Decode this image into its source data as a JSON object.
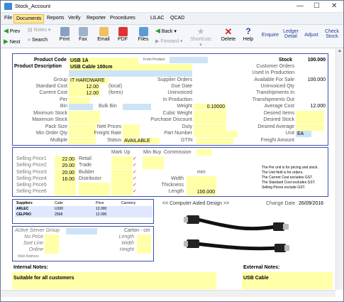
{
  "window": {
    "title": "Stock_Account",
    "min": "—",
    "max": "☐",
    "close": "✕"
  },
  "menu": [
    "File",
    "Documents",
    "Reports",
    "Verify",
    "Reporter",
    "Procedures",
    "LILAC",
    "QCAD"
  ],
  "toolbar": {
    "prev": "Prev",
    "next": "Next",
    "notes": "Notes",
    "search": "Search",
    "print": "Print",
    "fax": "Fax",
    "email": "Email",
    "pdf": "PDF",
    "files": "Files",
    "back": "Back",
    "forward": "Forward",
    "shortcuts": "Shortcuts",
    "delete": "Delete",
    "help": "Help",
    "enquire": "Enquire",
    "ledger1": "Ledger",
    "ledger2": "Detail",
    "adjust": "Adjust",
    "check1": "Check",
    "check2": "Stock"
  },
  "product": {
    "code_label": "Product Code",
    "code": "USB 1A",
    "from_product_label": "From Product",
    "desc_label": "Product Description",
    "desc": "USB Cable 100cm",
    "group_label": "Group",
    "group": "IT HARDWARE",
    "std_cost_label": "Standard Cost",
    "std_cost": "12.00",
    "local": "(local)",
    "cur_cost_label": "Current Cost",
    "cur_cost": "12.00",
    "forex": "(forex)",
    "per_label": "Per",
    "bin_label": "Bin",
    "bulk_bin_label": "Bulk Bin",
    "min_stock_label": "Minimum Stock",
    "max_stock_label": "Maximum Stock",
    "pack_size_label": "Pack Size",
    "nett_prices_label": "Nett Prices",
    "min_order_label": "Min Order Qty",
    "freight_rate_label": "Freight Rate",
    "multiple_label": "Multiple",
    "status_label": "Status",
    "status": "AVAILABLE",
    "gtin_label": "GTIN",
    "supplier_orders_label": "Supplier Orders",
    "due_date_label": "Due Date",
    "uninvoiced_label": "Uninvoiced",
    "in_production_label": "In Production",
    "weight_label": "Weight",
    "weight": "0.10000",
    "cubic_weight_label": "Cubic Weight",
    "purchase_discount_label": "Purchase Discount",
    "duty_label": "Duty",
    "part_number_label": "Part Number"
  },
  "stock": {
    "stock_label": "Stock",
    "stock": "100.000",
    "customer_orders_label": "Customer Orders",
    "used_in_production_label": "Used In Production",
    "available_label": "Available For Sale",
    "available": "100.000",
    "uninvoiced_qty_label": "Uninvoiced Qty",
    "transhipments_in_label": "Transhipments In",
    "transhipments_out_label": "Transhipments Out",
    "average_cost_label": "Average Cost",
    "average_cost": "12.000",
    "desired_items_label": "Desired Items",
    "desired_stock_label": "Desired Stock",
    "desired_average_label": "Desired Average",
    "unit_label": "Unit",
    "unit": "EA",
    "freight_amount_label": "Freight Amount"
  },
  "pricing": {
    "markup_label": "Mark Up",
    "minbuy_label": "Min Buy",
    "commission_label": "Commission",
    "rows": [
      {
        "label": "Selling Price1",
        "value": "22.00",
        "name": "Retail"
      },
      {
        "label": "Selling Price2",
        "value": "20.00",
        "name": "Trade"
      },
      {
        "label": "Selling Price3",
        "value": "20.00",
        "name": "Builder"
      },
      {
        "label": "Selling Price4",
        "value": "16.00",
        "name": "Distributor"
      },
      {
        "label": "Selling Price5",
        "value": "",
        "name": ""
      },
      {
        "label": "Selling Price6",
        "value": "",
        "name": ""
      }
    ],
    "mm_label": "mm",
    "width_label": "Width",
    "thickness_label": "Thickness",
    "length_label": "Length",
    "length": "100.000",
    "notes": [
      "The Per unit is for pricing and stock.",
      "The Unit field is for orders.",
      "The Current Cost excludes GST.",
      "The Standard Cost excludes GST.",
      "Selling Prices exclude GST."
    ]
  },
  "suppliers": {
    "headers": [
      "Suppliers",
      "Code",
      "Price",
      "Currency"
    ],
    "rows": [
      {
        "supplier": "ARLEC",
        "code": "U100",
        "price": "12.000"
      },
      {
        "supplier": "CELPRO",
        "code": "2568",
        "price": "12.000"
      }
    ]
  },
  "cad": {
    "label": "<< Computer Aided Design >>",
    "change_date_label": "Change Date",
    "change_date": "26/09/2016"
  },
  "server": {
    "group_label": "Active Server Group",
    "carton_label": "Carton - cm",
    "no_price_label": "No Price",
    "sort_line_label": "Sort Line",
    "online_label": "Online",
    "web_address_label": "Web Address",
    "length_label": "Length",
    "width_label": "Width",
    "height_label": "Height"
  },
  "notes": {
    "internal_label": "Internal Notes:",
    "internal": "Suitable for all customers",
    "external_label": "External Notes:",
    "external": "USB Cable"
  },
  "colors": {
    "field": "#ffffa8",
    "field_blue": "#cde3f7",
    "border": "#3b4fb0"
  }
}
